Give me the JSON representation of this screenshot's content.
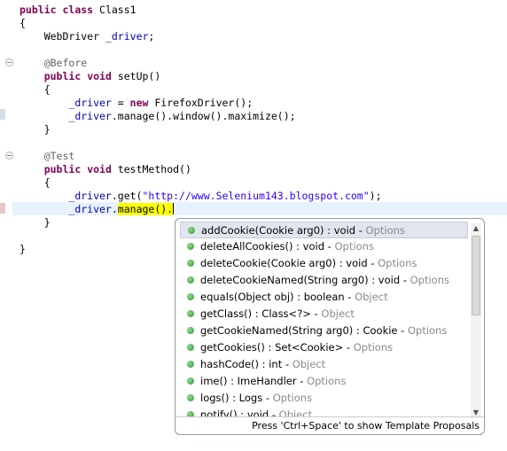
{
  "code": {
    "line1_kw1": "public",
    "line1_kw2": "class",
    "line1_name": " Class1",
    "line2": "{",
    "line3_type": "WebDriver ",
    "line3_field": "_driver",
    "line3_end": ";",
    "line4_annotation": "@Before",
    "line5_kw1": "public",
    "line5_kw2": "void",
    "line5_rest": " setUp()",
    "line6": "{",
    "line7_field": "_driver",
    "line7_mid": " = ",
    "line7_kw": "new",
    "line7_rest": " FirefoxDriver();",
    "line8_field": "_driver",
    "line8_rest": ".manage().window().maximize();",
    "line9": "}",
    "line10_annotation": "@Test",
    "line11_kw1": "public",
    "line11_kw2": "void",
    "line11_rest": " testMethod()",
    "line12": "{",
    "line13_field": "_driver",
    "line13_mid": ".get(",
    "line13_str": "\"http://www.Selenium143.blogspot.com\"",
    "line13_end": ");",
    "line14_field": "_driver",
    "line14_dot": ".",
    "line14_hl": "manage().",
    "line15": "}",
    "line16": "}"
  },
  "autocomplete": {
    "items": [
      {
        "sig": "addCookie(Cookie arg0) : void",
        "cls": "Options"
      },
      {
        "sig": "deleteAllCookies() : void",
        "cls": "Options"
      },
      {
        "sig": "deleteCookie(Cookie arg0) : void",
        "cls": "Options"
      },
      {
        "sig": "deleteCookieNamed(String arg0) : void",
        "cls": "Options"
      },
      {
        "sig": "equals(Object obj) : boolean",
        "cls": "Object"
      },
      {
        "sig": "getClass() : Class<?>",
        "cls": "Object"
      },
      {
        "sig": "getCookieNamed(String arg0) : Cookie",
        "cls": "Options"
      },
      {
        "sig": "getCookies() : Set<Cookie>",
        "cls": "Options"
      },
      {
        "sig": "hashCode() : int",
        "cls": "Object"
      },
      {
        "sig": "ime() : ImeHandler",
        "cls": "Options"
      },
      {
        "sig": "logs() : Logs",
        "cls": "Options"
      },
      {
        "sig": "notify() : void",
        "cls": "Object"
      }
    ],
    "separator": " - ",
    "scroll_up": "▲",
    "scroll_down": "▼",
    "footer": "Press 'Ctrl+Space' to show Template Proposals"
  }
}
